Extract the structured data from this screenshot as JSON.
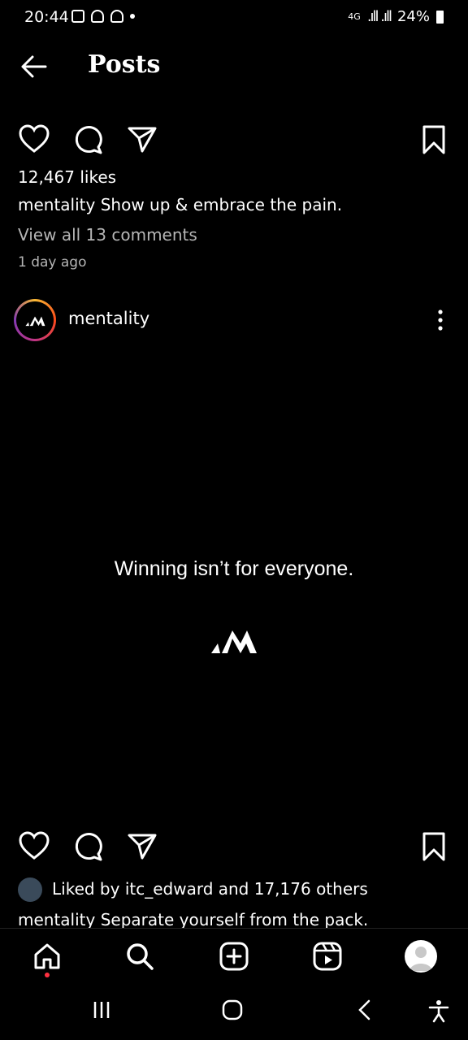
{
  "status_bar": {
    "time": "20:44",
    "network": "4G",
    "battery": "24%"
  },
  "header": {
    "title": "Posts"
  },
  "post1": {
    "likes": "12,467 likes",
    "caption_user": "mentality",
    "caption_text": "Show up & embrace the pain.",
    "comments_link": "View all 13 comments",
    "time_ago": "1 day ago"
  },
  "post2": {
    "username": "mentality",
    "image_text": "Winning isn’t for everyone.",
    "liked_by": "Liked by itc_edward and 17,176 others",
    "caption_user": "mentality",
    "caption_text": "Separate yourself from the pack."
  },
  "icons": {
    "like": "heart-icon",
    "comment": "comment-icon",
    "share": "send-icon",
    "save": "bookmark-icon",
    "home": "home-icon",
    "search": "search-icon",
    "create": "create-icon",
    "reels": "reels-icon",
    "profile": "profile-icon"
  },
  "colors": {
    "background": "#000000",
    "text": "#ffffff",
    "muted": "#b5b5b5",
    "notification": "#ff3040"
  }
}
